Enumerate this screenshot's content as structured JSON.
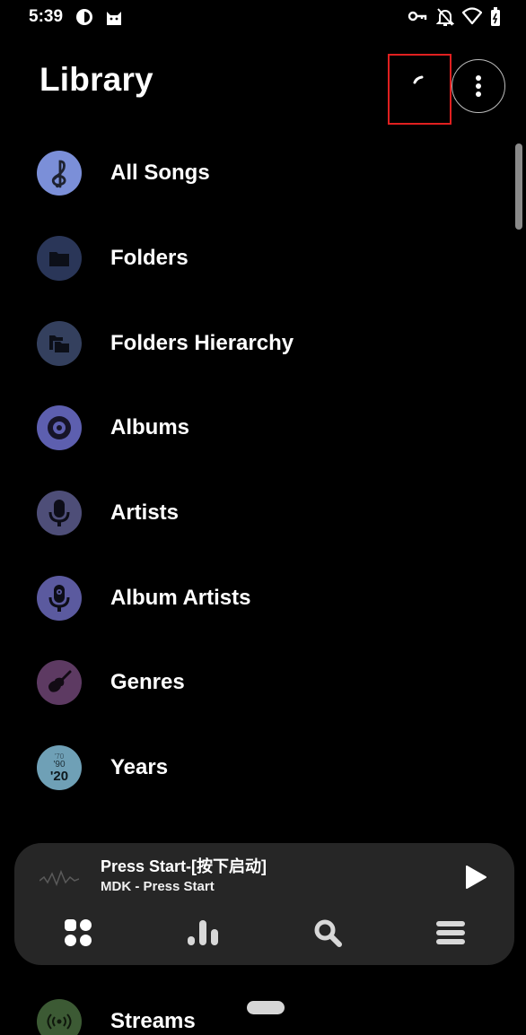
{
  "status_bar": {
    "time": "5:39",
    "icons": [
      "circle-half-icon",
      "cat-icon",
      "key-icon",
      "bell-off-icon",
      "wifi-icon",
      "battery-icon"
    ]
  },
  "header": {
    "title": "Library",
    "more_icon": "more-vertical-icon"
  },
  "library": {
    "items": [
      {
        "label": "All Songs",
        "icon": "treble-clef-icon",
        "color": "#7b8fd8"
      },
      {
        "label": "Folders",
        "icon": "folder-icon",
        "color": "#2a3658"
      },
      {
        "label": "Folders Hierarchy",
        "icon": "folders-icon",
        "color": "#34405e"
      },
      {
        "label": "Albums",
        "icon": "vinyl-icon",
        "color": "#5d5faf"
      },
      {
        "label": "Artists",
        "icon": "microphone-icon",
        "color": "#4e4e78"
      },
      {
        "label": "Album Artists",
        "icon": "microphone-speaker-icon",
        "color": "#5b5a9f"
      },
      {
        "label": "Genres",
        "icon": "guitar-icon",
        "color": "#5d3a62"
      },
      {
        "label": "Years",
        "icon": "years-icon",
        "color": "#6fa0b6",
        "years": [
          "'70",
          "'90",
          "'20"
        ]
      },
      {
        "label": "Streams",
        "icon": "radio-waves-icon",
        "color": "#3c5a34"
      }
    ]
  },
  "player": {
    "title": "Press Start-[按下启动]",
    "artist": "MDK - Press Start",
    "play_icon": "play-icon",
    "nav": [
      "grid-icon",
      "bar-chart-icon",
      "search-icon",
      "menu-icon"
    ]
  }
}
